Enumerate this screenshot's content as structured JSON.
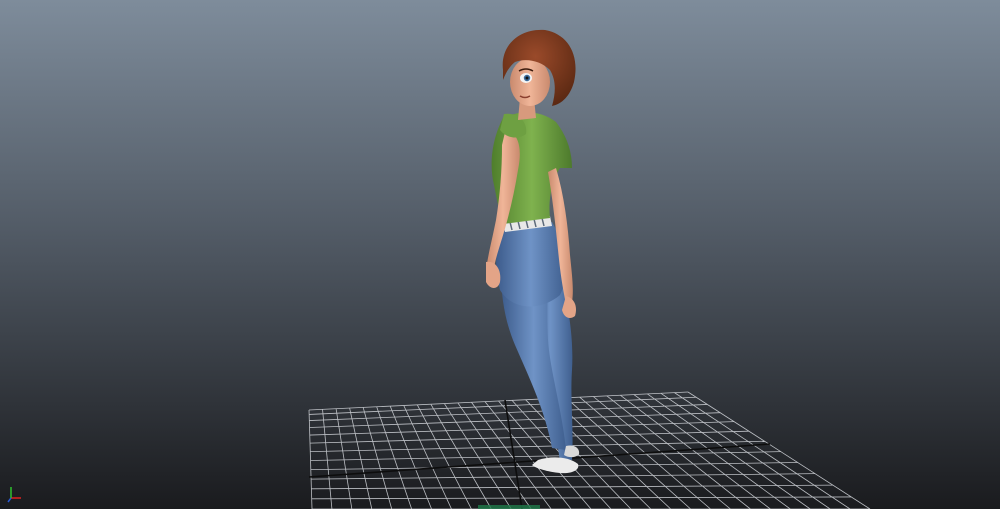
{
  "viewport": {
    "background_top": "#7e8c9b",
    "background_bottom": "#1a1b1e",
    "grid_color": "#d8dbe0",
    "grid_axis_color": "#111111"
  },
  "character": {
    "hair_color": "#7a3a22",
    "skin_color": "#e7a98c",
    "shirt_color": "#6ea042",
    "pants_color": "#5b7fb0",
    "belt_color": "#e8e8e8",
    "shoe_color": "#ebebeb"
  },
  "axis_gizmo": {
    "icon": "axis-gizmo-icon",
    "x_color": "#e02020",
    "y_color": "#2ec22e",
    "z_color": "#2a5bd8"
  }
}
